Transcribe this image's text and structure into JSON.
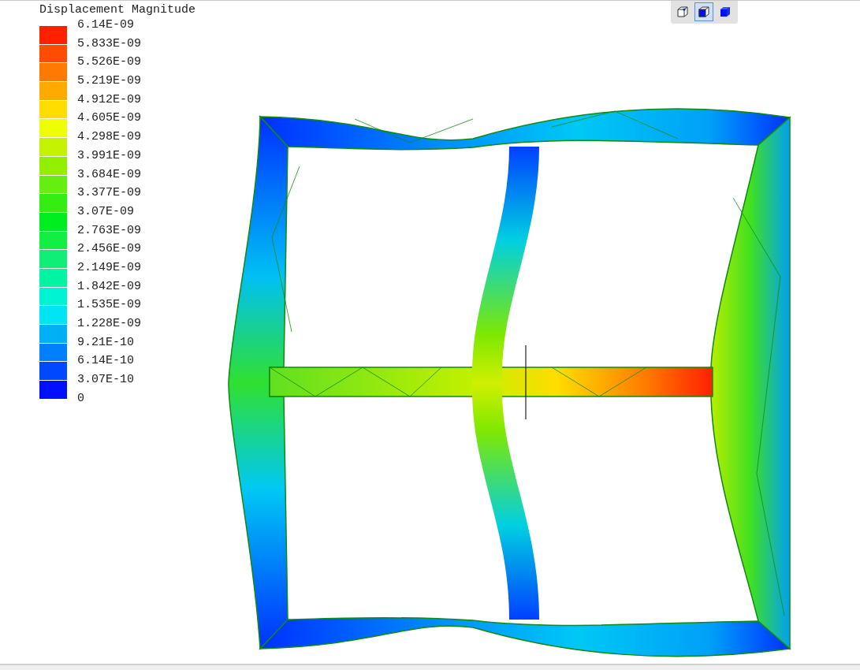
{
  "legend": {
    "title": "Displacement Magnitude",
    "bands": [
      {
        "label": "6.14E-09",
        "color": "#ff2000"
      },
      {
        "label": "5.833E-09",
        "color": "#ff4c00"
      },
      {
        "label": "5.526E-09",
        "color": "#ff7a00"
      },
      {
        "label": "5.219E-09",
        "color": "#ffaa00"
      },
      {
        "label": "4.912E-09",
        "color": "#ffdd00"
      },
      {
        "label": "4.605E-09",
        "color": "#eeff00"
      },
      {
        "label": "4.298E-09",
        "color": "#c4f200"
      },
      {
        "label": "3.991E-09",
        "color": "#94ee00"
      },
      {
        "label": "3.684E-09",
        "color": "#66ee10"
      },
      {
        "label": "3.377E-09",
        "color": "#33ee10"
      },
      {
        "label": "3.07E-09",
        "color": "#00ee20"
      },
      {
        "label": "2.763E-09",
        "color": "#11ee44"
      },
      {
        "label": "2.456E-09",
        "color": "#11ee77"
      },
      {
        "label": "2.149E-09",
        "color": "#00f4a4"
      },
      {
        "label": "1.842E-09",
        "color": "#00f4d4"
      },
      {
        "label": "1.535E-09",
        "color": "#00e4f4"
      },
      {
        "label": "1.228E-09",
        "color": "#00b0f4"
      },
      {
        "label": "9.21E-10",
        "color": "#0080ff"
      },
      {
        "label": "6.14E-10",
        "color": "#0048ff"
      },
      {
        "label": "3.07E-10",
        "color": "#0010ff"
      }
    ],
    "bottom_label": "0"
  },
  "toolbar": [
    {
      "kind": "wireframe",
      "selected": false
    },
    {
      "kind": "shaded-edges",
      "selected": true
    },
    {
      "kind": "shaded",
      "selected": false
    }
  ]
}
